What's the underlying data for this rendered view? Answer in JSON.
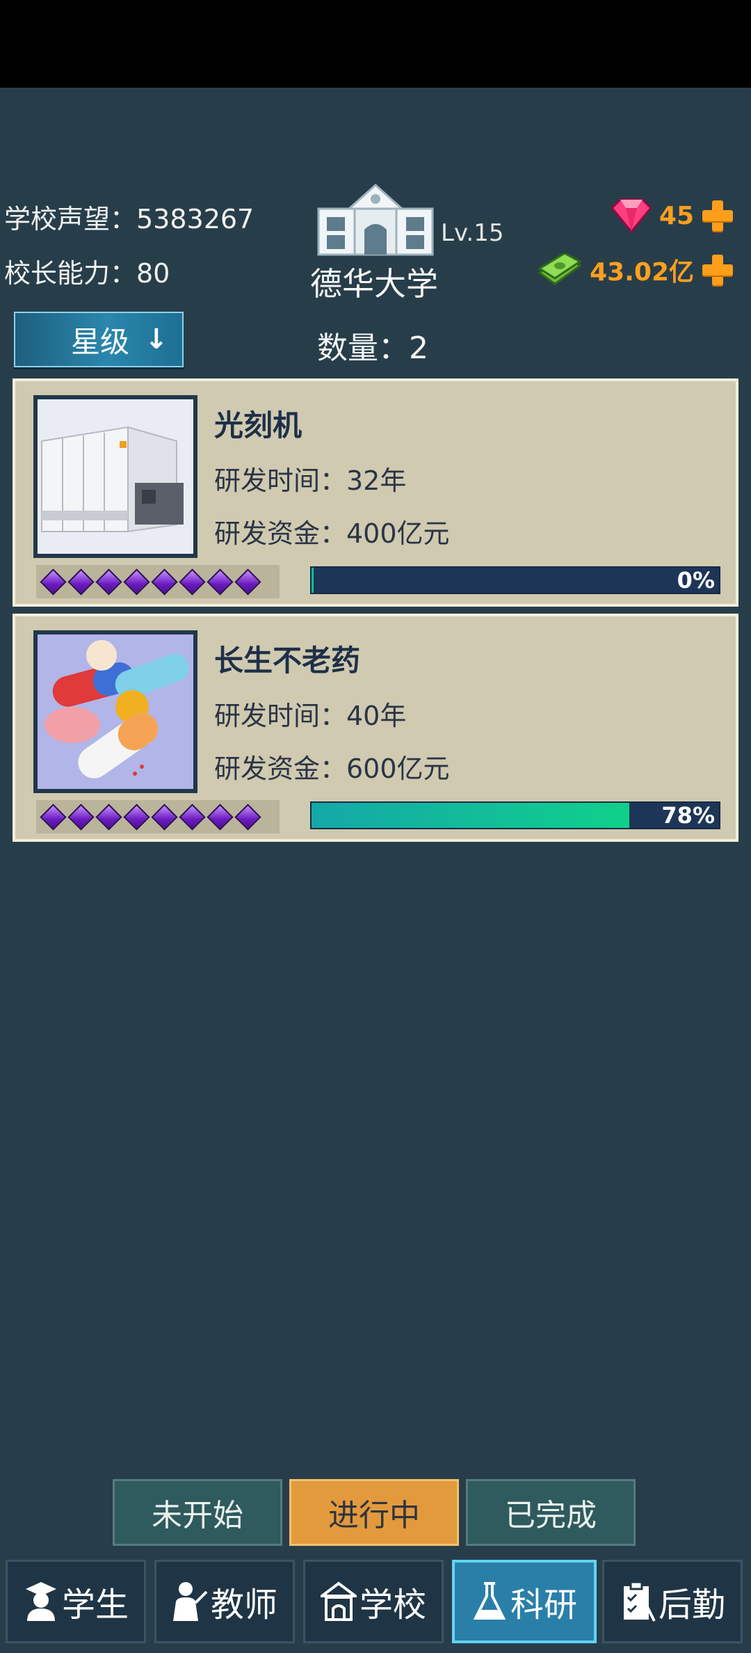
{
  "header": {
    "reputation": "学校声望：5383267",
    "ability": "校长能力：80",
    "school_level": "Lv.15",
    "school_name": "德华大学",
    "gems": "45",
    "money": "43.02亿"
  },
  "toolbar": {
    "sort_label": "星级",
    "sort_arrow": "↓",
    "count": "数量：2"
  },
  "projects": [
    {
      "title": "光刻机",
      "time": "研发时间：32年",
      "fund": "研发资金：400亿元",
      "stars": 8,
      "progress": 0,
      "progress_label": "0%",
      "icon": "lithography-machine-icon"
    },
    {
      "title": "长生不老药",
      "time": "研发时间：40年",
      "fund": "研发资金：600亿元",
      "stars": 8,
      "progress": 78,
      "progress_label": "78%",
      "icon": "pills-icon"
    }
  ],
  "filters": {
    "pending": "未开始",
    "in_progress": "进行中",
    "done": "已完成",
    "active": "in_progress"
  },
  "nav": {
    "students": "学生",
    "teachers": "教师",
    "school": "学校",
    "research": "科研",
    "logistics": "后勤",
    "active": "research"
  },
  "colors": {
    "background": "#273e4a",
    "card": "#cfcab0",
    "accent_orange": "#e39a3c",
    "progress_fill": "#0fd08a"
  }
}
